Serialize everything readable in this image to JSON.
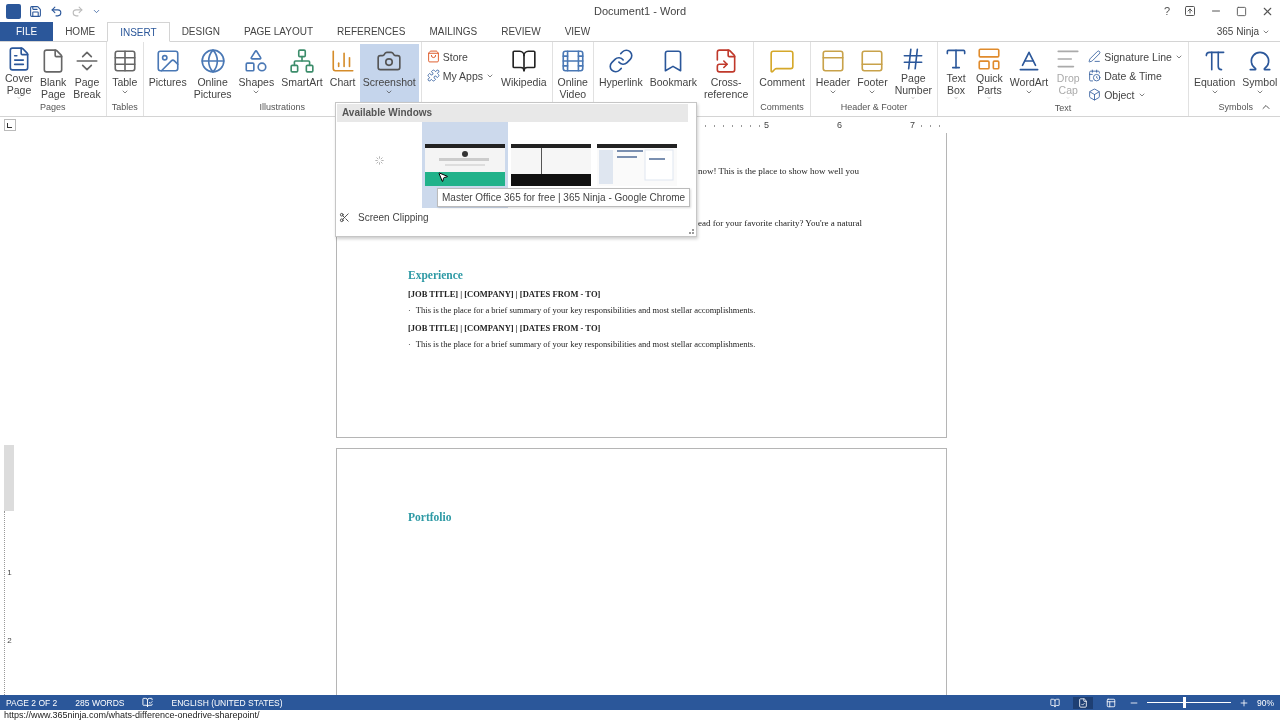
{
  "title_bar": {
    "title": "Document1 - Word",
    "help": "?",
    "quick_access": [
      {
        "kind": "save",
        "disabled": false
      },
      {
        "kind": "undo",
        "disabled": false
      },
      {
        "kind": "redo",
        "disabled": true
      }
    ]
  },
  "account": "365 Ninja",
  "tabs": [
    {
      "label": "FILE",
      "kind": "file",
      "selected": false
    },
    {
      "label": "HOME",
      "kind": "tab",
      "selected": false
    },
    {
      "label": "INSERT",
      "kind": "tab",
      "selected": true
    },
    {
      "label": "DESIGN",
      "kind": "tab",
      "selected": false
    },
    {
      "label": "PAGE LAYOUT",
      "kind": "tab",
      "selected": false
    },
    {
      "label": "REFERENCES",
      "kind": "tab",
      "selected": false
    },
    {
      "label": "MAILINGS",
      "kind": "tab",
      "selected": false
    },
    {
      "label": "REVIEW",
      "kind": "tab",
      "selected": false
    },
    {
      "label": "VIEW",
      "kind": "tab",
      "selected": false
    }
  ],
  "ribbon": {
    "groups": [
      {
        "label": "Pages",
        "items": [
          {
            "kind": "large",
            "lines": [
              "Cover",
              "Page"
            ],
            "dropdown": true,
            "selected": false,
            "disabled": false
          },
          {
            "kind": "large",
            "lines": [
              "Blank",
              "Page"
            ],
            "dropdown": false,
            "selected": false,
            "disabled": false
          },
          {
            "kind": "large",
            "lines": [
              "Page",
              "Break"
            ],
            "dropdown": false,
            "selected": false,
            "disabled": false
          }
        ]
      },
      {
        "label": "Tables",
        "items": [
          {
            "kind": "large",
            "lines": [
              "Table"
            ],
            "dropdown": true,
            "selected": false,
            "disabled": false
          }
        ]
      },
      {
        "label": "Illustrations",
        "items": [
          {
            "kind": "large",
            "lines": [
              "Pictures"
            ],
            "dropdown": false,
            "selected": false,
            "disabled": false
          },
          {
            "kind": "large",
            "lines": [
              "Online",
              "Pictures"
            ],
            "dropdown": false,
            "selected": false,
            "disabled": false
          },
          {
            "kind": "large",
            "lines": [
              "Shapes"
            ],
            "dropdown": true,
            "selected": false,
            "disabled": false
          },
          {
            "kind": "large",
            "lines": [
              "SmartArt"
            ],
            "dropdown": false,
            "selected": false,
            "disabled": false
          },
          {
            "kind": "large",
            "lines": [
              "Chart"
            ],
            "dropdown": false,
            "selected": false,
            "disabled": false
          },
          {
            "kind": "large",
            "lines": [
              "Screenshot"
            ],
            "dropdown": true,
            "selected": true,
            "disabled": false
          }
        ]
      },
      {
        "items": [
          {
            "kind": "small",
            "lines": [
              "Store"
            ],
            "dropdown": false,
            "selected": false,
            "disabled": false
          },
          {
            "kind": "small",
            "lines": [
              "My Apps"
            ],
            "dropdown": true,
            "selected": false,
            "disabled": false
          },
          {
            "kind": "large",
            "lines": [
              "Wikipedia"
            ],
            "dropdown": false,
            "selected": false,
            "disabled": false
          }
        ]
      },
      {
        "items": [
          {
            "kind": "large",
            "lines": [
              "Online",
              "Video"
            ],
            "dropdown": false,
            "selected": false,
            "disabled": false
          }
        ]
      },
      {
        "items": [
          {
            "kind": "large",
            "lines": [
              "Hyperlink"
            ],
            "dropdown": false,
            "selected": false,
            "disabled": false
          },
          {
            "kind": "large",
            "lines": [
              "Bookmark"
            ],
            "dropdown": false,
            "selected": false,
            "disabled": false
          },
          {
            "kind": "large",
            "lines": [
              "Cross-",
              "reference"
            ],
            "dropdown": false,
            "selected": false,
            "disabled": false
          }
        ]
      },
      {
        "label": "Comments",
        "items": [
          {
            "kind": "large",
            "lines": [
              "Comment"
            ],
            "dropdown": false,
            "selected": false,
            "disabled": false
          }
        ]
      },
      {
        "label": "Header & Footer",
        "items": [
          {
            "kind": "large",
            "lines": [
              "Header"
            ],
            "dropdown": true,
            "selected": false,
            "disabled": false
          },
          {
            "kind": "large",
            "lines": [
              "Footer"
            ],
            "dropdown": true,
            "selected": false,
            "disabled": false
          },
          {
            "kind": "large",
            "lines": [
              "Page",
              "Number"
            ],
            "dropdown": true,
            "selected": false,
            "disabled": false
          }
        ]
      },
      {
        "label": "Text",
        "items": [
          {
            "kind": "large",
            "lines": [
              "Text",
              "Box"
            ],
            "dropdown": true,
            "selected": false,
            "disabled": false
          },
          {
            "kind": "large",
            "lines": [
              "Quick",
              "Parts"
            ],
            "dropdown": true,
            "selected": false,
            "disabled": false
          },
          {
            "kind": "large",
            "lines": [
              "WordArt"
            ],
            "dropdown": true,
            "selected": false,
            "disabled": false
          },
          {
            "kind": "large",
            "lines": [
              "Drop",
              "Cap"
            ],
            "dropdown": true,
            "selected": false,
            "disabled": true
          },
          {
            "kind": "small",
            "lines": [
              "Signature Line"
            ],
            "dropdown": true,
            "selected": false,
            "disabled": false
          },
          {
            "kind": "small",
            "lines": [
              "Date & Time"
            ],
            "dropdown": false,
            "selected": false,
            "disabled": false
          },
          {
            "kind": "small",
            "lines": [
              "Object"
            ],
            "dropdown": true,
            "selected": false,
            "disabled": false
          }
        ]
      },
      {
        "label": "Symbols",
        "items": [
          {
            "kind": "large",
            "lines": [
              "Equation"
            ],
            "dropdown": true,
            "selected": false,
            "disabled": false
          },
          {
            "kind": "large",
            "lines": [
              "Symbol"
            ],
            "dropdown": true,
            "selected": false,
            "disabled": false
          }
        ]
      }
    ]
  },
  "screenshot_menu": {
    "header": "Available Windows",
    "windows": [
      {
        "selected": true
      },
      {
        "selected": false
      },
      {
        "selected": false
      }
    ],
    "tooltip": "Master Office 365 for free | 365 Ninja - Google Chrome",
    "clipping": "Screen Clipping"
  },
  "ruler": {
    "numbers": [
      "5",
      "6",
      "7"
    ],
    "vertical_numbers": [
      "1",
      "2"
    ]
  },
  "pages": [
    {
      "blocks": [
        {
          "kind": "fragment",
          "text": "now! This is the place to show how well you"
        },
        {
          "kind": "fragment",
          "text": "ead for your favorite charity? You're a natural"
        },
        {
          "kind": "heading",
          "text": "Experience"
        },
        {
          "kind": "job",
          "text": "[JOB TITLE] | [COMPANY] | [DATES FROM - TO]"
        },
        {
          "kind": "bullet",
          "bullet": "·",
          "text": "This is the place for a brief summary of your key responsibilities and most stellar accomplishments."
        },
        {
          "kind": "job",
          "text": "[JOB TITLE] | [COMPANY] | [DATES FROM - TO]"
        },
        {
          "kind": "bullet",
          "bullet": "·",
          "text": "This is the place for a brief summary of your key responsibilities and most stellar accomplishments."
        }
      ]
    },
    {
      "blocks": [
        {
          "kind": "heading",
          "text": "Portfolio"
        }
      ]
    }
  ],
  "status_bar": {
    "page": "PAGE 2 OF 2",
    "words": "285 WORDS",
    "language": "ENGLISH (UNITED STATES)",
    "views": [
      {
        "selected": false
      },
      {
        "selected": true
      },
      {
        "selected": false
      }
    ],
    "zoom": {
      "level": 0.44,
      "reading": "90%"
    }
  },
  "link_preview": "https://www.365ninja.com/whats-difference-onedrive-sharepoint/"
}
